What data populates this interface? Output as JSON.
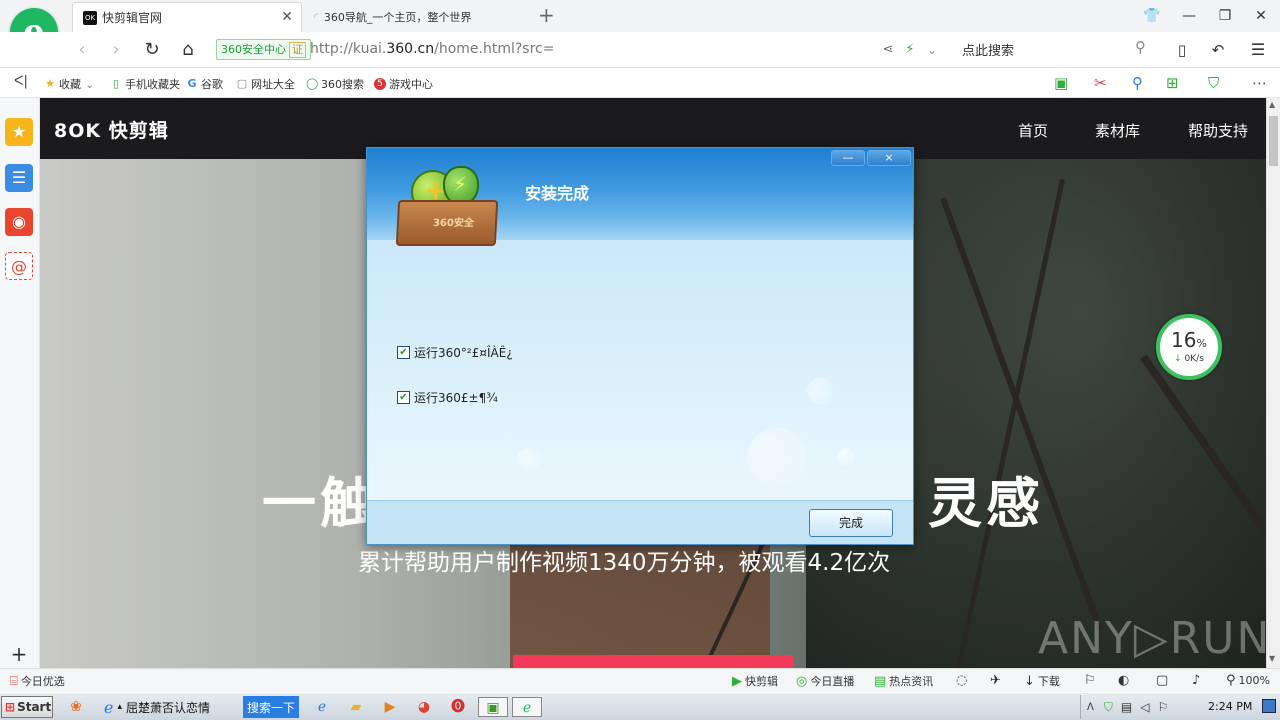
{
  "browser": {
    "tabs": [
      {
        "label": "快剪辑官网",
        "favicon": "kuaijianji-favicon"
      },
      {
        "label": "360导航_一个主页，整个世界",
        "favicon": "loading-icon"
      }
    ],
    "new_tab": "+",
    "url": {
      "prefix": "http://kuai.",
      "host": "360.cn",
      "rest": "/home.html?src="
    },
    "security_badge": "360安全中心",
    "security_cert": "证",
    "search_placeholder": "点此搜索",
    "bookmarks": [
      "收藏",
      "手机收藏夹",
      "谷歌",
      "网址大全",
      "360搜索",
      "游戏中心"
    ]
  },
  "site": {
    "logo": "8OK 快剪辑",
    "nav": [
      "首页",
      "素材库",
      "帮助支持"
    ],
    "hero_title_left": "一触",
    "hero_title_right": "灵感",
    "hero_subtitle": "累计帮助用户制作视频1340万分钟，被观看4.2亿次"
  },
  "speed_widget": {
    "percent": "16",
    "unit": "%",
    "rate": "0K/s"
  },
  "dialog": {
    "title": "安装完成",
    "box_label": "360安全",
    "options": [
      {
        "label": "运行360°²£¤ÎÀÊ¿",
        "checked": true
      },
      {
        "label": "运行360£±¶¾",
        "checked": true
      }
    ],
    "finish_button": "完成",
    "min_button": "—",
    "close_button": "×"
  },
  "statusbar": {
    "left": "今日优选",
    "items": [
      "快剪辑",
      "今日直播",
      "热点资讯"
    ],
    "download": "下载",
    "zoom": "100%"
  },
  "taskbar": {
    "start": "Start",
    "task1": "屈楚萧否认恋情",
    "search_btn": "搜索一下",
    "time": "2:24 PM"
  },
  "watermark": "ANY▷RUN"
}
